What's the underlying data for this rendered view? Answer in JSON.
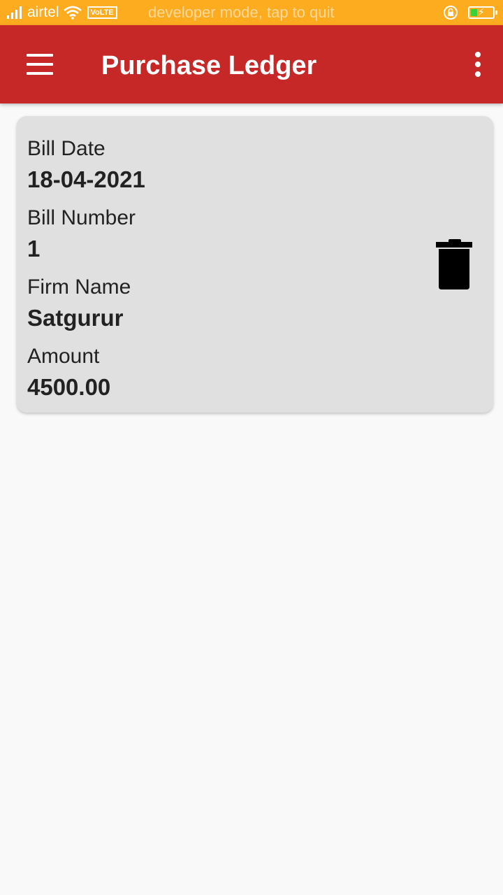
{
  "status_bar": {
    "carrier": "airtel",
    "network_badge": "VoLTE",
    "notice": "developer mode, tap to quit",
    "icons": [
      "signal-icon",
      "wifi-icon",
      "rotation-lock-icon",
      "battery-charging-icon"
    ],
    "background_color": "#fdab1f"
  },
  "app_bar": {
    "title": "Purchase Ledger",
    "menu_icon": "hamburger-menu-icon",
    "overflow_icon": "more-vertical-icon",
    "background_color": "#c62828"
  },
  "ledger_entries": [
    {
      "bill_date_label": "Bill Date",
      "bill_date": "18-04-2021",
      "bill_number_label": "Bill Number",
      "bill_number": "1",
      "firm_name_label": "Firm Name",
      "firm_name": "Satgurur",
      "amount_label": "Amount",
      "amount": "4500.00",
      "action_icon": "delete-icon"
    }
  ]
}
